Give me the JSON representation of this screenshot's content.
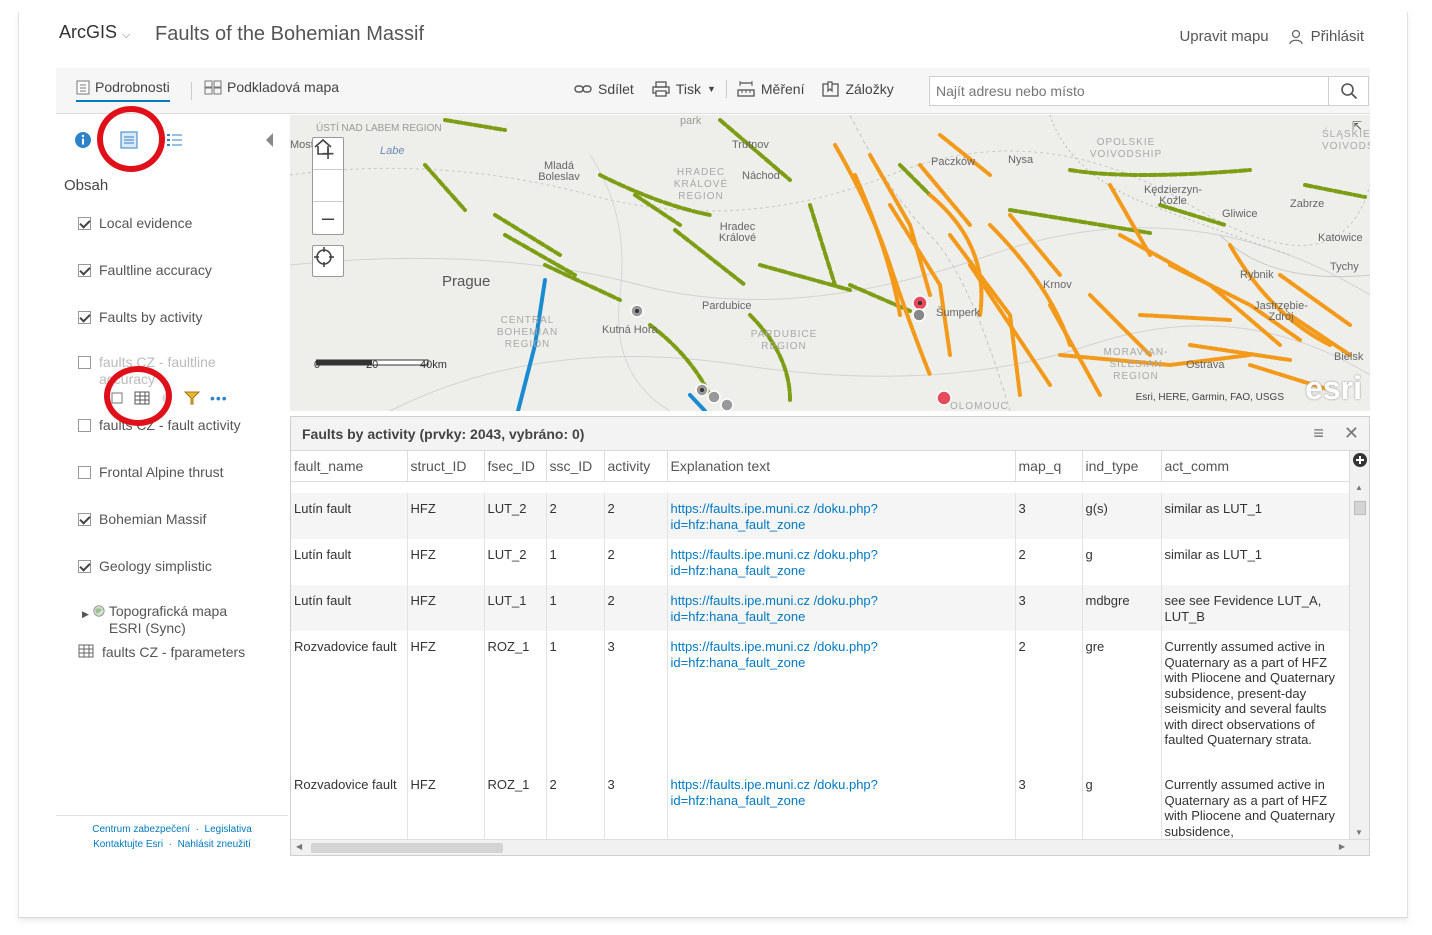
{
  "header": {
    "brand": "ArcGIS",
    "title": "Faults of the Bohemian Massif",
    "edit_map": "Upravit mapu",
    "sign_in": "Přihlásit"
  },
  "toolbar": {
    "tab_details": "Podrobnosti",
    "tab_basemap": "Podkladová mapa",
    "share": "Sdílet",
    "print": "Tisk",
    "measure": "Měření",
    "bookmarks": "Záložky",
    "search_placeholder": "Najít adresu nebo místo"
  },
  "left_panel": {
    "heading": "Obsah",
    "layers": [
      {
        "label": "Local evidence",
        "checked": true
      },
      {
        "label": "Faultline accuracy",
        "checked": true
      },
      {
        "label": "Faults by activity",
        "checked": true
      },
      {
        "label": "faults CZ - faultline accuracy",
        "checked": false
      },
      {
        "label": "faults CZ - fault activity",
        "checked": false
      },
      {
        "label": "Frontal Alpine thrust",
        "checked": false
      },
      {
        "label": "Bohemian Massif",
        "checked": true
      },
      {
        "label": "Geology simplistic",
        "checked": true
      },
      {
        "label": "Topografická mapa ESRI (Sync)",
        "checked": null
      },
      {
        "label": "faults CZ - fparameters",
        "checked": null
      }
    ],
    "footer_links": [
      "Centrum zabezpečení",
      "Legislativa",
      "Kontaktujte Esri",
      "Nahlásit zneužití"
    ]
  },
  "map": {
    "labels": {
      "prague": "Prague",
      "mlada_boleslav": "Mladá Boleslav",
      "trutnov": "Trutnov",
      "nachod": "Náchod",
      "hradec": "Hradec Králové",
      "hradec_region": "HRADEC KRÁLOVÉ REGION",
      "pardubice": "Pardubice",
      "pardubice_region": "PARDUBICE REGION",
      "central_bohemian": "CENTRAL BOHEMIAN REGION",
      "kutna_hora": "Kutná Hora",
      "sumperk": "Šumperk",
      "krnov": "Krnov",
      "paczkow": "Paczków",
      "nysa": "Nysa",
      "opolskie": "OPOLSKIE VOIVODSHIP",
      "kedzierzyn": "Kędzierzyn-Koźle",
      "gliwice": "Gliwice",
      "zabrze": "Zabrze",
      "katowice": "Katowice",
      "rybnik": "Rybnik",
      "tychy": "Tychy",
      "jastrzebie": "Jastrzębie-Zdrój",
      "moravian": "MORAVIAN-SILESIAN REGION",
      "ustinad": "ÚSTÍ NAD LABEM REGION",
      "labe": "Labe",
      "park": "park",
      "slask": "ŚLĄSKIE VOIVODSHIP",
      "bielsko": "Bielsk",
      "ostrava": "Ostrava",
      "olomouc": "OLOMOUC",
      "most": "Most"
    },
    "scale_labels": [
      "0",
      "20",
      "40km"
    ],
    "attribution": "Esri, HERE, Garmin, FAO, USGS",
    "esri_logo": "esri",
    "colors": {
      "green_fault": "#8fb11a",
      "orange_fault": "#f39a1a",
      "blue_fault": "#1b8bd1"
    }
  },
  "attribute_table": {
    "title": "Faults by activity (prvky: 2043, vybráno: 0)",
    "columns": [
      "fault_name",
      "struct_ID",
      "fsec_ID",
      "ssc_ID",
      "activity",
      "Explanation text",
      "map_q",
      "ind_type",
      "act_comm"
    ],
    "rows": [
      {
        "fault_name": "Lutín fault",
        "struct_ID": "HFZ",
        "fsec_ID": "LUT_2",
        "ssc_ID": "2",
        "activity": "2",
        "explanation": "https://faults.ipe.muni.cz /doku.php?id=hfz:hana_fault_zone",
        "map_q": "3",
        "ind_type": "g(s)",
        "act_comm": "similar as LUT_1"
      },
      {
        "fault_name": "Lutín fault",
        "struct_ID": "HFZ",
        "fsec_ID": "LUT_2",
        "ssc_ID": "1",
        "activity": "2",
        "explanation": "https://faults.ipe.muni.cz /doku.php?id=hfz:hana_fault_zone",
        "map_q": "2",
        "ind_type": "g",
        "act_comm": "similar as LUT_1"
      },
      {
        "fault_name": "Lutín fault",
        "struct_ID": "HFZ",
        "fsec_ID": "LUT_1",
        "ssc_ID": "1",
        "activity": "2",
        "explanation": "https://faults.ipe.muni.cz /doku.php?id=hfz:hana_fault_zone",
        "map_q": "3",
        "ind_type": "mdbgre",
        "act_comm": "see see Fevidence LUT_A, LUT_B"
      },
      {
        "fault_name": "Rozvadovice fault",
        "struct_ID": "HFZ",
        "fsec_ID": "ROZ_1",
        "ssc_ID": "1",
        "activity": "3",
        "explanation": "https://faults.ipe.muni.cz /doku.php?id=hfz:hana_fault_zone",
        "map_q": "2",
        "ind_type": "gre",
        "act_comm": "Currently assumed active in Quaternary as a part of HFZ with Pliocene and Quaternary subsidence, present-day seismicity and several faults with direct observations of faulted Quaternary strata."
      },
      {
        "fault_name": "Rozvadovice fault",
        "struct_ID": "HFZ",
        "fsec_ID": "ROZ_1",
        "ssc_ID": "2",
        "activity": "3",
        "explanation": "https://faults.ipe.muni.cz /doku.php?id=hfz:hana_fault_zone",
        "map_q": "3",
        "ind_type": "g",
        "act_comm": "Currently assumed active in Quaternary as a part of HFZ with Pliocene and Quaternary subsidence,"
      }
    ]
  }
}
